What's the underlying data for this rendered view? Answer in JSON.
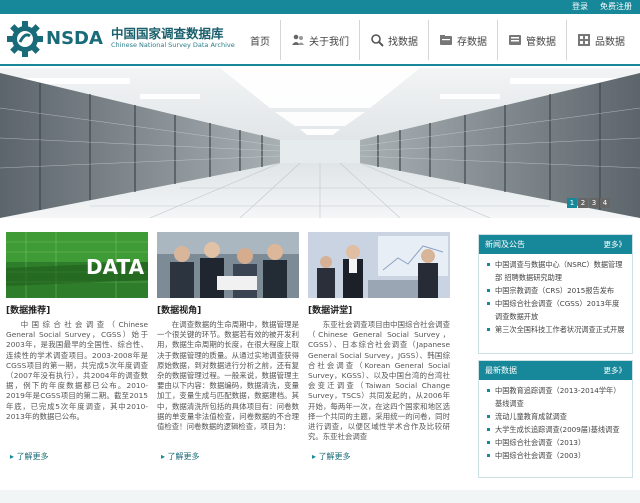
{
  "topbar": {
    "login": "登录",
    "register": "免费注册"
  },
  "logo": {
    "abbr": "NSDA",
    "name_cn": "中国国家调查数据库",
    "name_en": "Chinese National Survey Data Archive"
  },
  "nav": [
    {
      "label": "首页",
      "icon": "home"
    },
    {
      "label": "关于我们",
      "icon": "people-icon"
    },
    {
      "label": "找数据",
      "icon": "search-icon"
    },
    {
      "label": "存数据",
      "icon": "folder-icon"
    },
    {
      "label": "管数据",
      "icon": "database-icon"
    },
    {
      "label": "品数据",
      "icon": "grid-icon"
    }
  ],
  "banner": {
    "pages": [
      "1",
      "2",
      "3",
      "4"
    ],
    "active": 1
  },
  "columns": [
    {
      "thumb_text": "DATA",
      "title": "[数据推荐]",
      "body": "中国综合社会调查（Chinese General Social Survey，CGSS）始于2003年，是我国最早的全国性、综合性、连续性的学术调查项目。2003-2008年是CGSS项目的第一期，共完成5次年度调查（2007年没有执行），共2004年的调查数据，例下的年度数据都已公布。2010-2019年是CGSS项目的第二期。截至2015年底，已完成5次年度调查，其中2010-2013年的数据已公布。",
      "more": "了解更多"
    },
    {
      "title": "[数据视角]",
      "body": "在调查数据的生命周期中，数据管理是一个很关键的环节。数据若有效的被开发利用，数据生命周期的长度，在很大程度上取决于数据管理的质量。从通过实地调查获得原始数据，到对数据进行分析之前，还有复杂的数据管理过程。一般来说，数据管理主要由以下内容：数据编码，数据清洗，变量加工，变量生成与匹配数据，数据建档。其中，数据清洗所包括的具体项目有：问卷数据的单变量非法值检查，问卷数据的不合理值检查！问卷数据的逻辑检查，项目为：",
      "more": "了解更多"
    },
    {
      "title": "[数据讲堂]",
      "body": "东亚社会调查项目由中国综合社会调查（Chinese General Social Survey，CGSS）、日本综合社会调查（Japanese General Social Survey，JGSS）、韩国综合社会调查（Korean General Social Survey，KGSS）、以及中国台湾的台湾社会变迁调查（Taiwan Social Change Survey，TSCS）共同发起的，从2006年开始，每两年一次，在这四个国家和地区选择一个共同的主题，采用统一的问卷，同时进行调查，以便区域性学术合作及比较研究。东亚社会调查",
      "more": "了解更多"
    }
  ],
  "news": {
    "title": "新闻及公告",
    "more": "更多》",
    "items": [
      "中国调查与数据中心（NSRC）数据管理部 招聘数据研究助理",
      "中国宗教调查（CRS）2015报告发布",
      "中国综合社会调查（CGSS）2013年度调查数据开放",
      "第三次全国科技工作者状况调查正式开展"
    ]
  },
  "latest": {
    "title": "最新数据",
    "more": "更多》",
    "items": [
      "中国教育追踪调查（2013-2014学年）基线调查",
      "流动儿童教育成就调查",
      "大学生成长追踪调查(2009届)基线调查",
      "中国综合社会调查（2013）",
      "中国综合社会调查（2003）"
    ]
  }
}
